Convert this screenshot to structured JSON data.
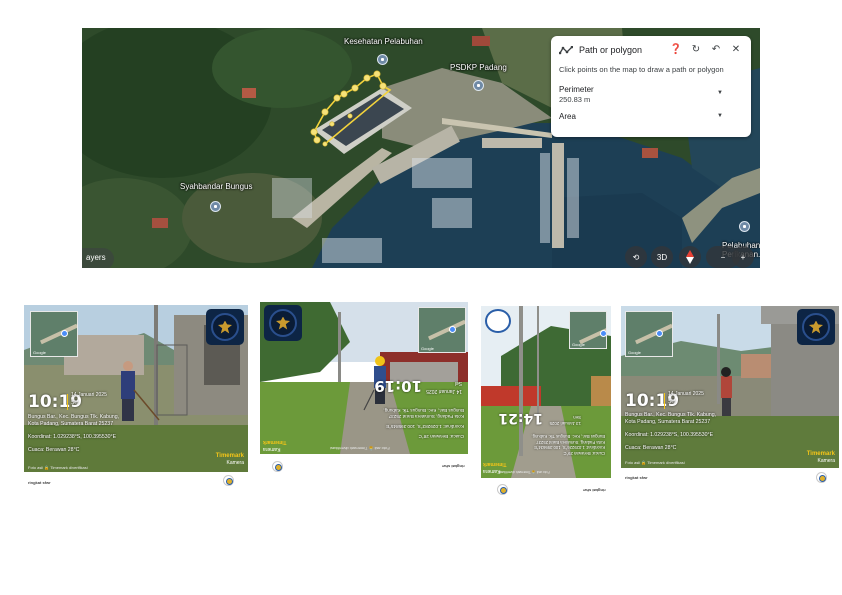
{
  "map": {
    "places": {
      "kesehatan": "Kesehatan Pelabuhan",
      "psdkp": "PSDKP Padang",
      "syahbandar": "Syahbandar Bungus",
      "pelabuhan": "Pelabuhan\nPerikanan..."
    },
    "layers_label": "ayers",
    "panel": {
      "title": "Path or polygon",
      "instruction": "Click points on the map to draw a path or polygon",
      "perimeter_label": "Perimeter",
      "perimeter_value": "250.83 m",
      "area_label": "Area"
    },
    "controls": {
      "three_d": "3D"
    },
    "polygon_color": "#f3d33c"
  },
  "photos": [
    {
      "time": "10:19",
      "date": "14 Januari 2025",
      "day": "Sel",
      "address": [
        "Bungus Bar., Kec. Bungus Tlk. Kabung,",
        "Kota Padang, Sumatera Barat 25237"
      ],
      "coords": "Koordinat: 1.029238°S, 100.395530°E",
      "weather": "Cuaca: Berawan 28°C",
      "brand": "Timemark",
      "brand_sub": "Kamera",
      "footer": "Foto asli 🔒 Timemark diverifikasi",
      "caption": "ringkat sfwr",
      "minimap_label": "Google"
    },
    {
      "time": "10:19",
      "date": "14 Januari 2025",
      "day": "Sel",
      "address": [
        "Bungus Bar., Kec. Bungus Tlk. Kabung,",
        "Kota Padang, Sumatera Barat 25237"
      ],
      "coords": "Koordinat: 1.029283°S, 100.395845°E",
      "weather": "Cuaca: Berawan 28°C",
      "brand": "Timemark",
      "brand_sub": "Kamera",
      "footer": "Foto asli 🔒 Timemark diverifikasi",
      "caption": "ringkat sfwr",
      "minimap_label": "Google"
    },
    {
      "time": "14:21",
      "date": "13 Januari 2025",
      "day": "Sen",
      "address": [
        "Bungus Bar., Kec. Bungus Tlk. Kabung,",
        "Kota Padang, Sumatera Barat 25237"
      ],
      "coords": "Koordinat: 1.029226°S, 100.395634°E",
      "weather": "Cuaca: Berawan 29°C",
      "brand": "Timemark",
      "brand_sub": "Kamera",
      "footer": "Foto asli 🔒 Timemark diverifikasi",
      "caption": "ringkat sfwr",
      "minimap_label": "Google"
    },
    {
      "time": "10:19",
      "date": "14 Januari 2025",
      "day": "Sel",
      "address": [
        "Bungus Bar., Kec. Bungus Tlk. Kabung,",
        "Kota Padang, Sumatera Barat 25237"
      ],
      "coords": "Koordinat: 1.029238°S, 100.395530°E",
      "weather": "Cuaca: Berawan 28°C",
      "brand": "Timemark",
      "brand_sub": "Kamera",
      "footer": "Foto asli 🔒 Timemark diverifikasi",
      "caption": "ringkat sfwr",
      "minimap_label": "Google"
    }
  ]
}
